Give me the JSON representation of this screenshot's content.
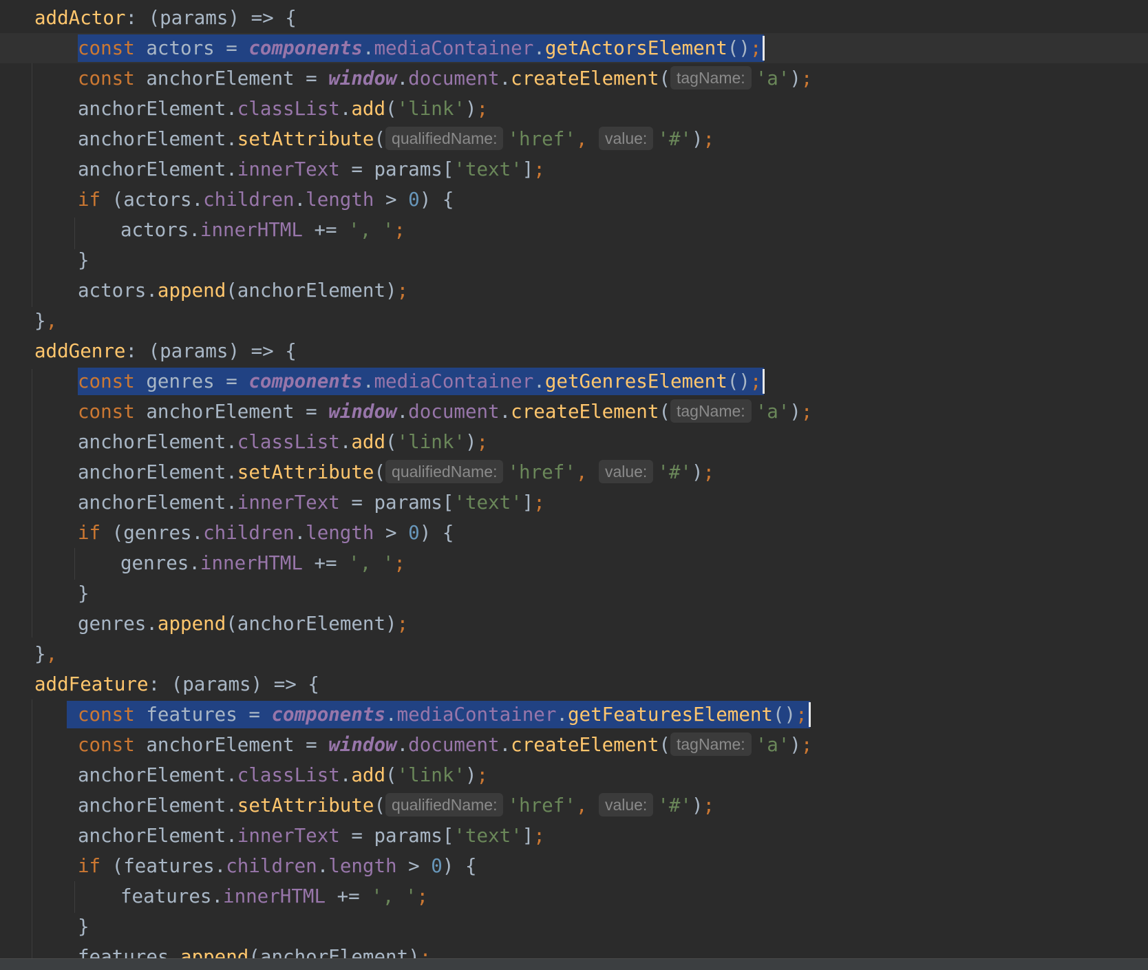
{
  "editor": {
    "language": "javascript",
    "theme_colors": {
      "background": "#2b2b2b",
      "selection": "#214283",
      "keyword": "#cc7832",
      "function": "#ffc66d",
      "property": "#9876aa",
      "string": "#6a8759",
      "number": "#6897bb",
      "default": "#a9b7c6"
    },
    "lines": [
      {
        "indent": 0,
        "tokens": [
          [
            "fn",
            "addActor"
          ],
          [
            "def",
            ": (params) => {"
          ]
        ]
      },
      {
        "indent": 1,
        "selected": true,
        "caret": true,
        "tokens": [
          [
            "kw",
            "const "
          ],
          [
            "def",
            "actors = "
          ],
          [
            "glob",
            "components"
          ],
          [
            "def",
            "."
          ],
          [
            "prop",
            "mediaContainer"
          ],
          [
            "def",
            "."
          ],
          [
            "fn",
            "getActorsElement"
          ],
          [
            "def",
            "()"
          ],
          [
            "punc",
            ";"
          ]
        ]
      },
      {
        "indent": 1,
        "tokens": [
          [
            "kw",
            "const "
          ],
          [
            "def",
            "anchorElement = "
          ],
          [
            "glob",
            "window"
          ],
          [
            "def",
            "."
          ],
          [
            "prop",
            "document"
          ],
          [
            "def",
            "."
          ],
          [
            "fn",
            "createElement"
          ],
          [
            "def",
            "("
          ],
          [
            "hint",
            "tagName:"
          ],
          [
            "str",
            "'a'"
          ],
          [
            "def",
            ")"
          ],
          [
            "punc",
            ";"
          ]
        ]
      },
      {
        "indent": 1,
        "tokens": [
          [
            "def",
            "anchorElement."
          ],
          [
            "prop",
            "classList"
          ],
          [
            "def",
            "."
          ],
          [
            "fn",
            "add"
          ],
          [
            "def",
            "("
          ],
          [
            "str",
            "'link'"
          ],
          [
            "def",
            ")"
          ],
          [
            "punc",
            ";"
          ]
        ]
      },
      {
        "indent": 1,
        "tokens": [
          [
            "def",
            "anchorElement."
          ],
          [
            "fn",
            "setAttribute"
          ],
          [
            "def",
            "("
          ],
          [
            "hint",
            "qualifiedName:"
          ],
          [
            "str",
            "'href'"
          ],
          [
            "punc",
            ", "
          ],
          [
            "hint",
            "value:"
          ],
          [
            "str",
            "'#'"
          ],
          [
            "def",
            ")"
          ],
          [
            "punc",
            ";"
          ]
        ]
      },
      {
        "indent": 1,
        "tokens": [
          [
            "def",
            "anchorElement."
          ],
          [
            "prop",
            "innerText"
          ],
          [
            "def",
            " = params["
          ],
          [
            "str",
            "'text'"
          ],
          [
            "def",
            "]"
          ],
          [
            "punc",
            ";"
          ]
        ]
      },
      {
        "indent": 1,
        "tokens": [
          [
            "kw",
            "if "
          ],
          [
            "def",
            "(actors."
          ],
          [
            "prop",
            "children"
          ],
          [
            "def",
            "."
          ],
          [
            "prop",
            "length"
          ],
          [
            "def",
            " > "
          ],
          [
            "num",
            "0"
          ],
          [
            "def",
            ") {"
          ]
        ]
      },
      {
        "indent": 2,
        "tokens": [
          [
            "def",
            "actors."
          ],
          [
            "prop",
            "innerHTML"
          ],
          [
            "def",
            " += "
          ],
          [
            "str",
            "', '"
          ],
          [
            "punc",
            ";"
          ]
        ]
      },
      {
        "indent": 1,
        "tokens": [
          [
            "def",
            "}"
          ]
        ]
      },
      {
        "indent": 1,
        "tokens": [
          [
            "def",
            "actors."
          ],
          [
            "fn",
            "append"
          ],
          [
            "def",
            "(anchorElement)"
          ],
          [
            "punc",
            ";"
          ]
        ]
      },
      {
        "indent": 0,
        "tokens": [
          [
            "def",
            "}"
          ],
          [
            "punc",
            ","
          ]
        ]
      },
      {
        "indent": 0,
        "tokens": [
          [
            "fn",
            "addGenre"
          ],
          [
            "def",
            ": (params) => {"
          ]
        ]
      },
      {
        "indent": 1,
        "selected": true,
        "caret": true,
        "tokens": [
          [
            "kw",
            "const "
          ],
          [
            "def",
            "genres = "
          ],
          [
            "glob",
            "components"
          ],
          [
            "def",
            "."
          ],
          [
            "prop",
            "mediaContainer"
          ],
          [
            "def",
            "."
          ],
          [
            "fn",
            "getGenresElement"
          ],
          [
            "def",
            "()"
          ],
          [
            "punc",
            ";"
          ]
        ]
      },
      {
        "indent": 1,
        "tokens": [
          [
            "kw",
            "const "
          ],
          [
            "def",
            "anchorElement = "
          ],
          [
            "glob",
            "window"
          ],
          [
            "def",
            "."
          ],
          [
            "prop",
            "document"
          ],
          [
            "def",
            "."
          ],
          [
            "fn",
            "createElement"
          ],
          [
            "def",
            "("
          ],
          [
            "hint",
            "tagName:"
          ],
          [
            "str",
            "'a'"
          ],
          [
            "def",
            ")"
          ],
          [
            "punc",
            ";"
          ]
        ]
      },
      {
        "indent": 1,
        "tokens": [
          [
            "def",
            "anchorElement."
          ],
          [
            "prop",
            "classList"
          ],
          [
            "def",
            "."
          ],
          [
            "fn",
            "add"
          ],
          [
            "def",
            "("
          ],
          [
            "str",
            "'link'"
          ],
          [
            "def",
            ")"
          ],
          [
            "punc",
            ";"
          ]
        ]
      },
      {
        "indent": 1,
        "tokens": [
          [
            "def",
            "anchorElement."
          ],
          [
            "fn",
            "setAttribute"
          ],
          [
            "def",
            "("
          ],
          [
            "hint",
            "qualifiedName:"
          ],
          [
            "str",
            "'href'"
          ],
          [
            "punc",
            ", "
          ],
          [
            "hint",
            "value:"
          ],
          [
            "str",
            "'#'"
          ],
          [
            "def",
            ")"
          ],
          [
            "punc",
            ";"
          ]
        ]
      },
      {
        "indent": 1,
        "tokens": [
          [
            "def",
            "anchorElement."
          ],
          [
            "prop",
            "innerText"
          ],
          [
            "def",
            " = params["
          ],
          [
            "str",
            "'text'"
          ],
          [
            "def",
            "]"
          ],
          [
            "punc",
            ";"
          ]
        ]
      },
      {
        "indent": 1,
        "tokens": [
          [
            "kw",
            "if "
          ],
          [
            "def",
            "(genres."
          ],
          [
            "prop",
            "children"
          ],
          [
            "def",
            "."
          ],
          [
            "prop",
            "length"
          ],
          [
            "def",
            " > "
          ],
          [
            "num",
            "0"
          ],
          [
            "def",
            ") {"
          ]
        ]
      },
      {
        "indent": 2,
        "tokens": [
          [
            "def",
            "genres."
          ],
          [
            "prop",
            "innerHTML"
          ],
          [
            "def",
            " += "
          ],
          [
            "str",
            "', '"
          ],
          [
            "punc",
            ";"
          ]
        ]
      },
      {
        "indent": 1,
        "tokens": [
          [
            "def",
            "}"
          ]
        ]
      },
      {
        "indent": 1,
        "tokens": [
          [
            "def",
            "genres."
          ],
          [
            "fn",
            "append"
          ],
          [
            "def",
            "(anchorElement)"
          ],
          [
            "punc",
            ";"
          ]
        ]
      },
      {
        "indent": 0,
        "tokens": [
          [
            "def",
            "}"
          ],
          [
            "punc",
            ","
          ]
        ]
      },
      {
        "indent": 0,
        "tokens": [
          [
            "fn",
            "addFeature"
          ],
          [
            "def",
            ": (params) => {"
          ]
        ]
      },
      {
        "indent": 1,
        "selected": true,
        "caret": true,
        "wide_selection": true,
        "tokens": [
          [
            "kw",
            "const "
          ],
          [
            "def",
            "features = "
          ],
          [
            "glob",
            "components"
          ],
          [
            "def",
            "."
          ],
          [
            "prop",
            "mediaContainer"
          ],
          [
            "def",
            "."
          ],
          [
            "fn",
            "getFeaturesElement"
          ],
          [
            "def",
            "()"
          ],
          [
            "punc",
            ";"
          ]
        ]
      },
      {
        "indent": 1,
        "tokens": [
          [
            "kw",
            "const "
          ],
          [
            "def",
            "anchorElement = "
          ],
          [
            "glob",
            "window"
          ],
          [
            "def",
            "."
          ],
          [
            "prop",
            "document"
          ],
          [
            "def",
            "."
          ],
          [
            "fn",
            "createElement"
          ],
          [
            "def",
            "("
          ],
          [
            "hint",
            "tagName:"
          ],
          [
            "str",
            "'a'"
          ],
          [
            "def",
            ")"
          ],
          [
            "punc",
            ";"
          ]
        ]
      },
      {
        "indent": 1,
        "tokens": [
          [
            "def",
            "anchorElement."
          ],
          [
            "prop",
            "classList"
          ],
          [
            "def",
            "."
          ],
          [
            "fn",
            "add"
          ],
          [
            "def",
            "("
          ],
          [
            "str",
            "'link'"
          ],
          [
            "def",
            ")"
          ],
          [
            "punc",
            ";"
          ]
        ]
      },
      {
        "indent": 1,
        "tokens": [
          [
            "def",
            "anchorElement."
          ],
          [
            "fn",
            "setAttribute"
          ],
          [
            "def",
            "("
          ],
          [
            "hint",
            "qualifiedName:"
          ],
          [
            "str",
            "'href'"
          ],
          [
            "punc",
            ", "
          ],
          [
            "hint",
            "value:"
          ],
          [
            "str",
            "'#'"
          ],
          [
            "def",
            ")"
          ],
          [
            "punc",
            ";"
          ]
        ]
      },
      {
        "indent": 1,
        "tokens": [
          [
            "def",
            "anchorElement."
          ],
          [
            "prop",
            "innerText"
          ],
          [
            "def",
            " = params["
          ],
          [
            "str",
            "'text'"
          ],
          [
            "def",
            "]"
          ],
          [
            "punc",
            ";"
          ]
        ]
      },
      {
        "indent": 1,
        "tokens": [
          [
            "kw",
            "if "
          ],
          [
            "def",
            "(features."
          ],
          [
            "prop",
            "children"
          ],
          [
            "def",
            "."
          ],
          [
            "prop",
            "length"
          ],
          [
            "def",
            " > "
          ],
          [
            "num",
            "0"
          ],
          [
            "def",
            ") {"
          ]
        ]
      },
      {
        "indent": 2,
        "tokens": [
          [
            "def",
            "features."
          ],
          [
            "prop",
            "innerHTML"
          ],
          [
            "def",
            " += "
          ],
          [
            "str",
            "', '"
          ],
          [
            "punc",
            ";"
          ]
        ]
      },
      {
        "indent": 1,
        "tokens": [
          [
            "def",
            "}"
          ]
        ]
      },
      {
        "indent": 1,
        "clipped": true,
        "tokens": [
          [
            "def",
            "features."
          ],
          [
            "fn",
            "append"
          ],
          [
            "def",
            "(anchorElement)"
          ],
          [
            "punc",
            ";"
          ]
        ]
      }
    ]
  },
  "statusbar": {
    "breadcrumb": ""
  }
}
